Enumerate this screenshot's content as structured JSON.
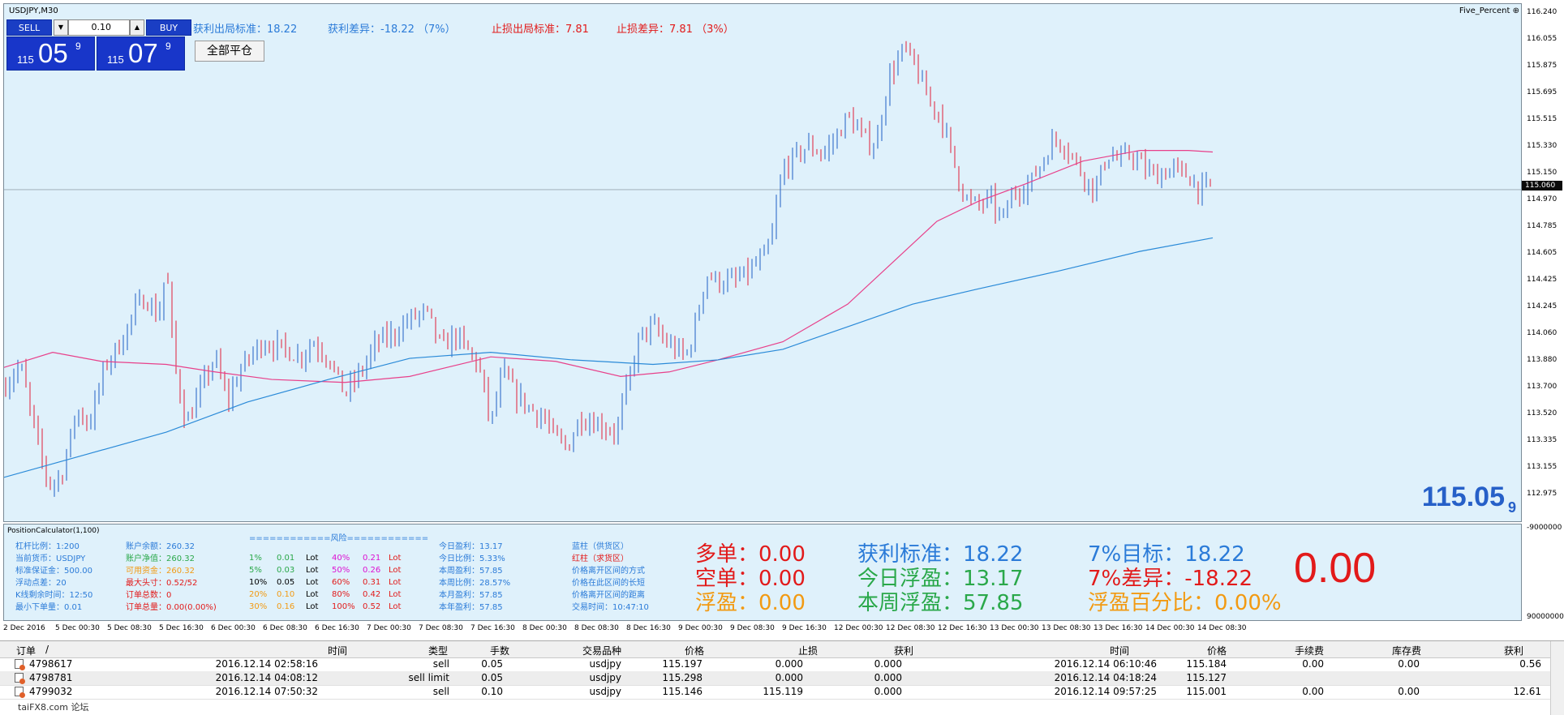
{
  "chart": {
    "symbol": "USDJPY,M30",
    "indicator": "Five_Percent",
    "bid_big": "115.05",
    "bid_small": "9",
    "price_axis": [
      "116.240",
      "116.055",
      "115.875",
      "115.695",
      "115.515",
      "115.330",
      "115.150",
      "114.970",
      "114.785",
      "114.605",
      "114.425",
      "114.245",
      "114.060",
      "113.880",
      "113.700",
      "113.520",
      "113.335",
      "113.155",
      "112.975"
    ],
    "current_price": "115.060",
    "time_axis": [
      "2 Dec 2016",
      "5 Dec 00:30",
      "5 Dec 08:30",
      "5 Dec 16:30",
      "6 Dec 00:30",
      "6 Dec 08:30",
      "6 Dec 16:30",
      "7 Dec 00:30",
      "7 Dec 08:30",
      "7 Dec 16:30",
      "8 Dec 00:30",
      "8 Dec 08:30",
      "8 Dec 16:30",
      "9 Dec 00:30",
      "9 Dec 08:30",
      "9 Dec 16:30",
      "12 Dec 00:30",
      "12 Dec 08:30",
      "12 Dec 16:30",
      "13 Dec 00:30",
      "13 Dec 08:30",
      "13 Dec 16:30",
      "14 Dec 00:30",
      "14 Dec 08:30"
    ],
    "colors": {
      "bull": "#1f5fc4",
      "bear": "#e0203a",
      "ma_fast": "#e8408a",
      "ma_slow": "#2a8ad8"
    }
  },
  "trading": {
    "sell_label": "SELL",
    "buy_label": "BUY",
    "lot": "0.10",
    "sell_small": "115",
    "sell_big": "05",
    "sell_sup": "9",
    "buy_small": "115",
    "buy_big": "07",
    "buy_sup": "9",
    "close_all": "全部平仓"
  },
  "top_info": {
    "tp_std": "获利出局标准：18.22",
    "tp_diff": "获利差异：-18.22 （7%）",
    "sl_std": "止损出局标准：7.81",
    "sl_diff": "止损差异：7.81 （3%）"
  },
  "sub": {
    "title": "PositionCalculator(1,100)",
    "top_right_value": "-9000000",
    "bottom_right_value": "90000000",
    "acct_labels": [
      "杠杆比例：1:200",
      "当前货币：USDJPY",
      "标准保证金：500.00",
      "浮动点差：20",
      "K线剩余时间：12:50",
      "最小下单量：0.01"
    ],
    "balance_labels": [
      "账户余额：260.32",
      "账户净值：260.32",
      "可用资金：260.32",
      "最大头寸：0.52/52",
      "订单总数：0",
      "订单总量：0.00(0.00%)"
    ],
    "risk_header": "============风险============",
    "risk_rows": [
      [
        "1%",
        "0.01",
        "Lot",
        "40%",
        "0.21",
        "Lot"
      ],
      [
        "5%",
        "0.03",
        "Lot",
        "50%",
        "0.26",
        "Lot"
      ],
      [
        "10%",
        "0.05",
        "Lot",
        "60%",
        "0.31",
        "Lot"
      ],
      [
        "20%",
        "0.10",
        "Lot",
        "80%",
        "0.42",
        "Lot"
      ],
      [
        "30%",
        "0.16",
        "Lot",
        "100%",
        "0.52",
        "Lot"
      ]
    ],
    "profit_labels": [
      "今日盈利：13.17",
      "今日比例：5.33%",
      "本周盈利：57.85",
      "本周比例：28.57%",
      "本月盈利：57.85",
      "本年盈利：57.85"
    ],
    "zone_labels": [
      "蓝柱（供货区）",
      "红柱（求货区）",
      "价格离开区间的方式",
      "价格在此区间的长短",
      "价格离开区间的距离",
      "交易时间：10:47:10"
    ],
    "big_left": [
      "多单：0.00",
      "空单：0.00",
      "浮盈：0.00"
    ],
    "big_mid": [
      "获利标准：18.22",
      "今日浮盈：13.17",
      "本周浮盈：57.85"
    ],
    "big_right": [
      "7%目标：18.22",
      "7%差异：-18.22",
      "浮盈百分比：0.00%"
    ],
    "huge": "0.00"
  },
  "trade_table": {
    "headers": [
      "订单",
      "/",
      "时间",
      "类型",
      "手数",
      "交易品种",
      "价格",
      "止损",
      "获利",
      "时间",
      "价格",
      "手续费",
      "库存费",
      "获利"
    ],
    "rows": [
      [
        "4798617",
        "2016.12.14 02:58:16",
        "sell",
        "0.05",
        "usdjpy",
        "115.197",
        "0.000",
        "0.000",
        "2016.12.14 06:10:46",
        "115.184",
        "0.00",
        "0.00",
        "0.56"
      ],
      [
        "4798781",
        "2016.12.14 04:08:12",
        "sell limit",
        "0.05",
        "usdjpy",
        "115.298",
        "0.000",
        "0.000",
        "2016.12.14 04:18:24",
        "115.127",
        "",
        "",
        ""
      ],
      [
        "4799032",
        "2016.12.14 07:50:32",
        "sell",
        "0.10",
        "usdjpy",
        "115.146",
        "115.119",
        "0.000",
        "2016.12.14 09:57:25",
        "115.001",
        "0.00",
        "0.00",
        "12.61"
      ]
    ],
    "watermark": "taiFX8.com 论坛"
  }
}
